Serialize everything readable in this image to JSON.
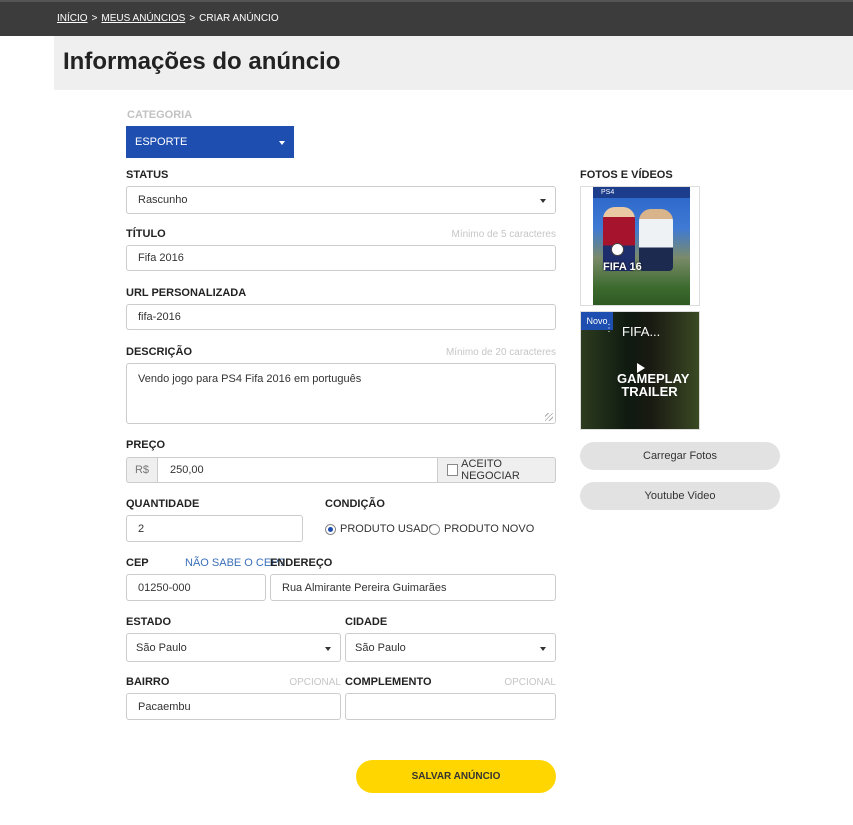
{
  "breadcrumb": {
    "home": "INÍCIO",
    "sep": ">",
    "my_ads": "MEUS ANÚNCIOS",
    "current": "CRIAR ANÚNCIO"
  },
  "page_title": "Informações do anúncio",
  "form": {
    "categoria": {
      "label": "CATEGORIA",
      "value": "ESPORTE"
    },
    "status": {
      "label": "STATUS",
      "value": "Rascunho"
    },
    "titulo": {
      "label": "TÍTULO",
      "hint": "Mínimo de 5 caracteres",
      "value": "Fifa 2016"
    },
    "url": {
      "label": "URL PERSONALIZADA",
      "value": "fifa-2016"
    },
    "descricao": {
      "label": "DESCRIÇÃO",
      "hint": "Mínimo de 20 caracteres",
      "value": "Vendo jogo para PS4 Fifa 2016 em português"
    },
    "preco": {
      "label": "PREÇO",
      "currency": "R$",
      "value": "250,00",
      "negociar": "ACEITO NEGOCIAR"
    },
    "quantidade": {
      "label": "QUANTIDADE",
      "value": "2"
    },
    "condicao": {
      "label": "CONDIÇÃO",
      "options": [
        "PRODUTO USADO",
        "PRODUTO NOVO"
      ],
      "selected": "PRODUTO USADO"
    },
    "cep": {
      "label": "CEP",
      "help_link": "NÃO SABE O CEP?",
      "value": "01250-000"
    },
    "endereco": {
      "label": "ENDEREÇO",
      "value": "Rua Almirante Pereira Guimarães"
    },
    "estado": {
      "label": "ESTADO",
      "value": "São Paulo"
    },
    "cidade": {
      "label": "CIDADE",
      "value": "São Paulo"
    },
    "bairro": {
      "label": "BAIRRO",
      "hint": "OPCIONAL",
      "value": "Pacaembu"
    },
    "complemento": {
      "label": "COMPLEMENTO",
      "hint": "OPCIONAL",
      "value": ""
    }
  },
  "media": {
    "label": "FOTOS E VÍDEOS",
    "cover": {
      "platform": "PS4",
      "title": "FIFA 16"
    },
    "video": {
      "badge": "Novo",
      "title": "FIFA...",
      "caption": "GAMEPLAY TRAILER"
    },
    "upload_button": "Carregar Fotos",
    "youtube_button": "Youtube Video"
  },
  "save_button": "SALVAR ANÚNCIO",
  "colors": {
    "primary_blue": "#1e4fb0",
    "save_yellow": "#ffd600",
    "topbar": "#3c3c3c"
  }
}
